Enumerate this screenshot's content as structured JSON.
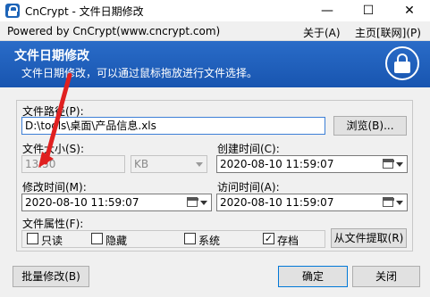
{
  "window": {
    "title": "CnCrypt - 文件日期修改",
    "minimize": "—",
    "maximize": "☐",
    "close": "✕"
  },
  "menubar": {
    "powered_by": "Powered by CnCrypt(www.cncrypt.com)",
    "about": "关于(A)",
    "home": "主页[联网](P)"
  },
  "banner": {
    "title": "文件日期修改",
    "subtitle": "文件日期修改，可以通过鼠标拖放进行文件选择。"
  },
  "form": {
    "path_label": "文件路径(P):",
    "path_value": "D:\\tools\\桌面\\产品信息.xls",
    "browse_button": "浏览(B)...",
    "size_label": "文件大小(S):",
    "size_value": "13.50",
    "size_unit": "KB",
    "created_label": "创建时间(C):",
    "created_value": "2020-08-10 11:59:07",
    "modified_label": "修改时间(M):",
    "modified_value": "2020-08-10 11:59:07",
    "accessed_label": "访问时间(A):",
    "accessed_value": "2020-08-10 11:59:07",
    "attributes_label": "文件属性(F):",
    "attributes": [
      {
        "label": "只读",
        "checked": false
      },
      {
        "label": "隐藏",
        "checked": false
      },
      {
        "label": "系统",
        "checked": false
      },
      {
        "label": "存档",
        "checked": true
      }
    ],
    "extract_button": "从文件提取(R)"
  },
  "footer": {
    "batch_button": "批量修改(B)",
    "ok_button": "确定",
    "close_button": "关闭"
  },
  "colors": {
    "banner": "#1d5fbf",
    "arrow": "#e02020"
  }
}
